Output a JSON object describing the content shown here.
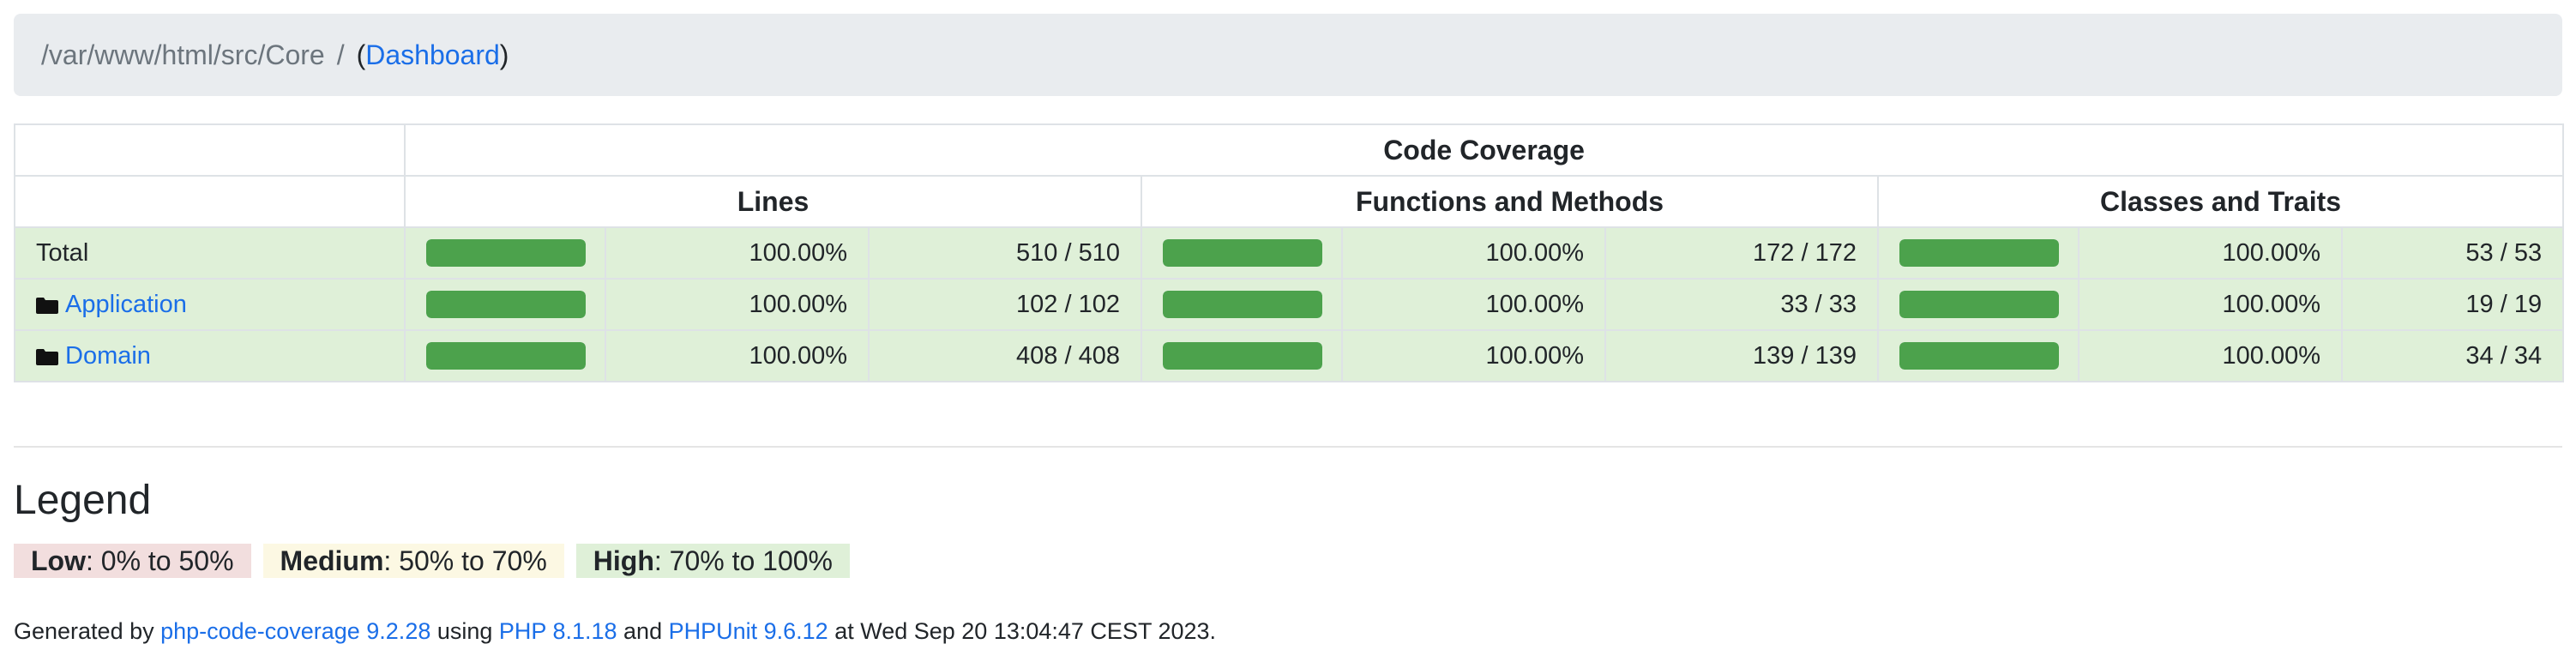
{
  "breadcrumb": {
    "path": "/var/www/html/src/Core",
    "separator": "/",
    "open_paren": "(",
    "dashboard_link": "Dashboard",
    "close_paren": ")"
  },
  "table": {
    "group_header": "Code Coverage",
    "columns": [
      "Lines",
      "Functions and Methods",
      "Classes and Traits"
    ],
    "rows": [
      {
        "name": "Total",
        "is_link": false,
        "lines": {
          "fraction": 1.0,
          "percent": "100.00%",
          "count": "510 / 510"
        },
        "functions": {
          "fraction": 1.0,
          "percent": "100.00%",
          "count": "172 / 172"
        },
        "classes": {
          "fraction": 1.0,
          "percent": "100.00%",
          "count": "53 / 53"
        }
      },
      {
        "name": "Application",
        "is_link": true,
        "lines": {
          "fraction": 1.0,
          "percent": "100.00%",
          "count": "102 / 102"
        },
        "functions": {
          "fraction": 1.0,
          "percent": "100.00%",
          "count": "33 / 33"
        },
        "classes": {
          "fraction": 1.0,
          "percent": "100.00%",
          "count": "19 / 19"
        }
      },
      {
        "name": "Domain",
        "is_link": true,
        "lines": {
          "fraction": 1.0,
          "percent": "100.00%",
          "count": "408 / 408"
        },
        "functions": {
          "fraction": 1.0,
          "percent": "100.00%",
          "count": "139 / 139"
        },
        "classes": {
          "fraction": 1.0,
          "percent": "100.00%",
          "count": "34 / 34"
        }
      }
    ]
  },
  "legend": {
    "title": "Legend",
    "low_label": "Low",
    "low_range": ": 0% to 50%",
    "medium_label": "Medium",
    "medium_range": ": 50% to 70%",
    "high_label": "High",
    "high_range": ": 70% to 100%"
  },
  "footer": {
    "generated_by": "Generated by ",
    "tool_link": "php-code-coverage 9.2.28",
    "using": " using ",
    "php_link": "PHP 8.1.18",
    "and": " and ",
    "phpunit_link": "PHPUnit 9.6.12",
    "suffix": " at Wed Sep 20 13:04:47 CEST 2023."
  },
  "colors": {
    "link": "#1a6ee8",
    "high_bg": "#dff0d8",
    "medium_bg": "#fcf8e3",
    "low_bg": "#f2dede",
    "bar_fill": "#4ca24c"
  },
  "icons": {
    "folder": "folder-icon"
  }
}
